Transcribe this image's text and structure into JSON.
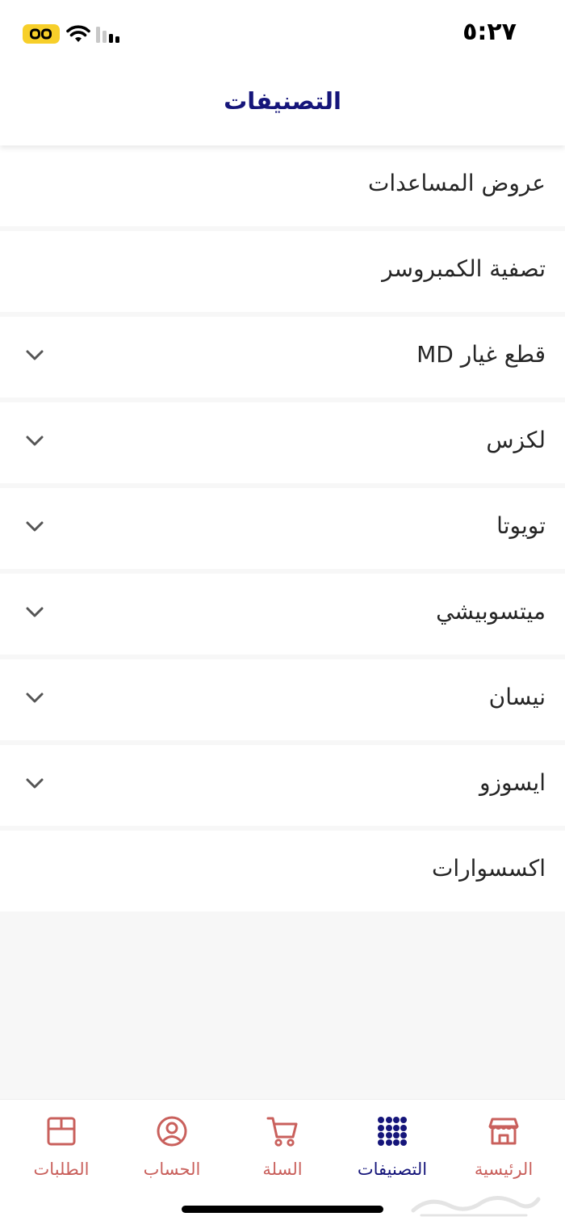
{
  "status_bar": {
    "time": "٥:٢٧"
  },
  "header": {
    "title": "التصنيفات"
  },
  "categories": [
    {
      "label": "عروض المساعدات",
      "expandable": false
    },
    {
      "label": "تصفية الكمبروسر",
      "expandable": false
    },
    {
      "label": "قطع غيار MD",
      "expandable": true
    },
    {
      "label": "لكزس",
      "expandable": true
    },
    {
      "label": "تويوتا",
      "expandable": true
    },
    {
      "label": "ميتسوبيشي",
      "expandable": true
    },
    {
      "label": "نيسان",
      "expandable": true
    },
    {
      "label": "ايسوزو",
      "expandable": true
    },
    {
      "label": "اكسسوارات",
      "expandable": false
    }
  ],
  "bottom_nav": {
    "items": [
      {
        "label": "الرئيسية",
        "icon": "store-icon"
      },
      {
        "label": "التصنيفات",
        "icon": "grid-dots-icon",
        "active": true
      },
      {
        "label": "السلة",
        "icon": "cart-icon"
      },
      {
        "label": "الحساب",
        "icon": "account-icon"
      },
      {
        "label": "الطلبات",
        "icon": "box-icon"
      }
    ]
  },
  "colors": {
    "accent": "#15157a",
    "inactive": "#c9605c",
    "background": "#f7f7f7",
    "battery": "#f7cf2a"
  }
}
